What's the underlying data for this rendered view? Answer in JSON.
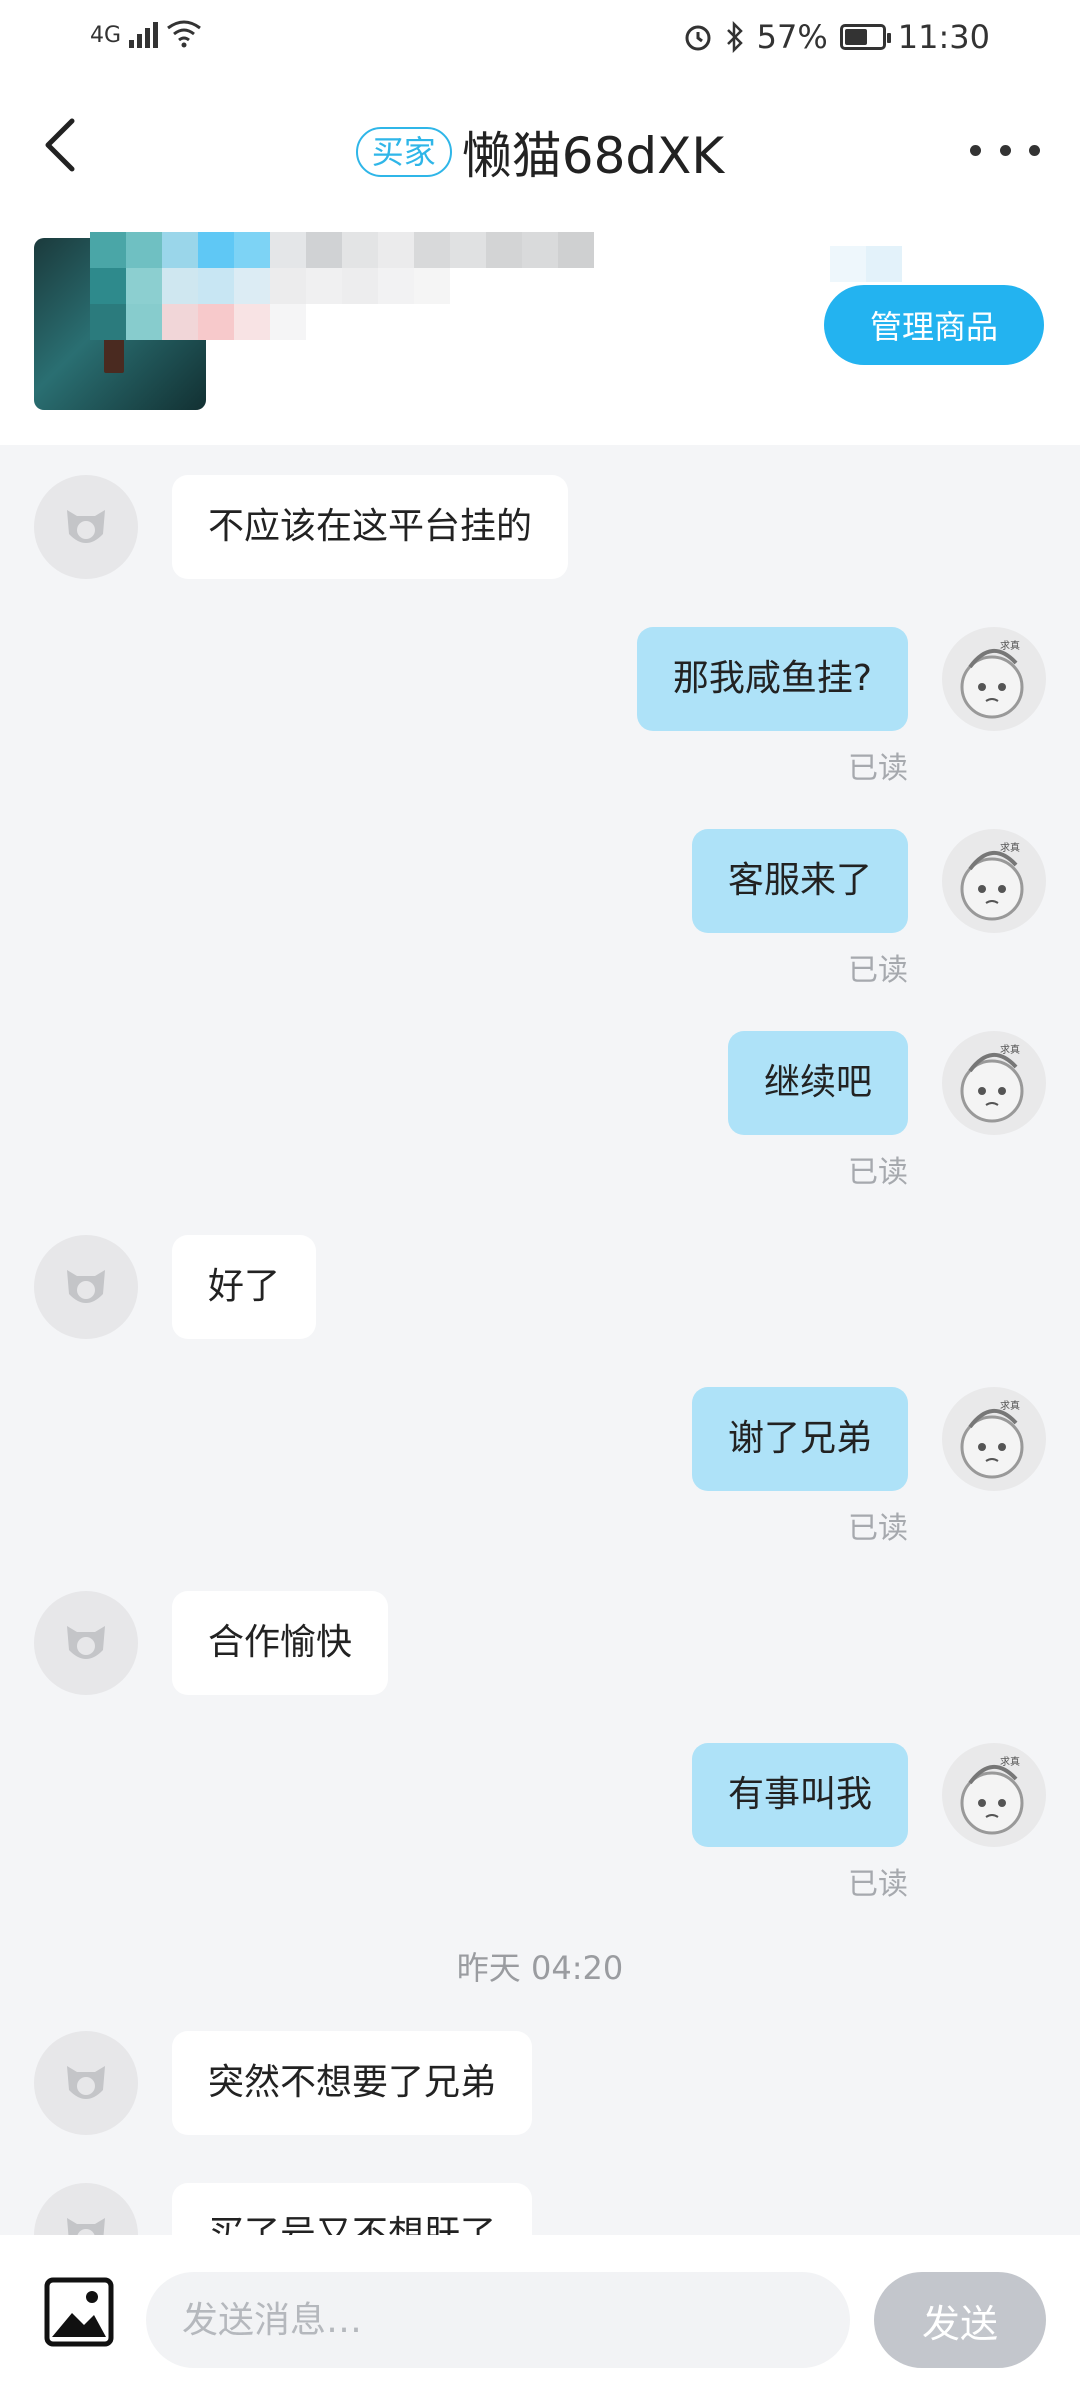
{
  "status_bar": {
    "network": "4G",
    "battery": "57%",
    "time": "11:30",
    "icons": [
      "signal-icon",
      "wifi-icon",
      "alarm-icon",
      "bluetooth-icon",
      "battery-icon"
    ]
  },
  "header": {
    "role_tag": "买家",
    "title": "懒猫68dXK",
    "back_icon": "back-arrow-icon",
    "more_icon": "more-dots-icon"
  },
  "product": {
    "manage_label": "管理商品"
  },
  "messages": [
    {
      "side": "left",
      "text": "不应该在这平台挂的"
    },
    {
      "side": "right",
      "text": "那我咸鱼挂?",
      "status": "已读"
    },
    {
      "side": "right",
      "text": "客服来了",
      "status": "已读"
    },
    {
      "side": "right",
      "text": "继续吧",
      "status": "已读"
    },
    {
      "side": "left",
      "text": "好了"
    },
    {
      "side": "right",
      "text": "谢了兄弟",
      "status": "已读"
    },
    {
      "side": "left",
      "text": "合作愉快"
    },
    {
      "side": "right",
      "text": "有事叫我",
      "status": "已读"
    },
    {
      "type": "timestamp",
      "text": "昨天 04:20"
    },
    {
      "side": "left",
      "text": "突然不想要了兄弟"
    },
    {
      "side": "left",
      "text": "买了号又不想肝了"
    }
  ],
  "composer": {
    "placeholder": "发送消息…",
    "send_label": "发送",
    "image_icon": "image-icon"
  },
  "colors": {
    "accent": "#23b3f0",
    "bubble_self": "#aee2f8",
    "bubble_other": "#ffffff",
    "background": "#f4f5f7",
    "read_text": "#a6a9ae"
  }
}
